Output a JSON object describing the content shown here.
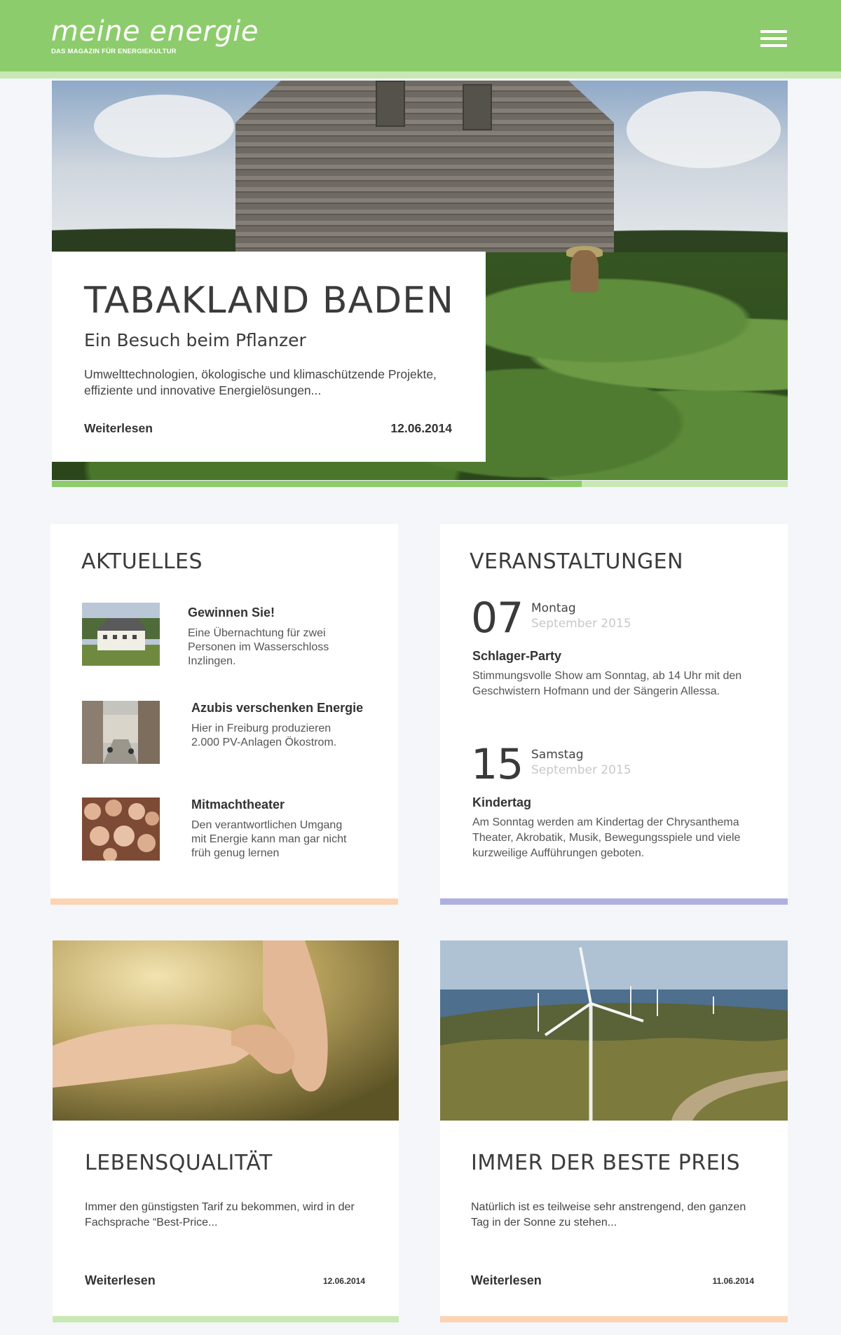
{
  "brand": {
    "title": "meine energie",
    "subtitle": "DAS MAGAZIN FÜR ENERGIEKULTUR"
  },
  "header": {
    "menu_icon": "hamburger-menu-icon",
    "color": "#8dcc6c"
  },
  "hero": {
    "title": "TABAKLAND BADEN",
    "subtitle": "Ein Besuch beim Pflanzer",
    "text": "Umwelttechnologien, ökologische und klimaschützende Projekte, effiziente und innovative Energielösungen...",
    "link": "Weiterlesen",
    "date": "12.06.2014",
    "progress": 0.72
  },
  "aktuelles": {
    "heading": "AKTUELLES",
    "accent": "#fcd4b4",
    "items": [
      {
        "title": "Gewinnen Sie!",
        "text": "Eine Übernachtung für zwei Personen im Wasserschloss Inzlingen."
      },
      {
        "title": "Azubis verschenken Energie",
        "text": "Hier in Freiburg produzieren 2.000 PV-Anlagen Ökostrom."
      },
      {
        "title": "Mitmachtheater",
        "text": "Den verantwortlichen Umgang mit Energie kann man gar nicht früh genug lernen"
      }
    ]
  },
  "veranstaltungen": {
    "heading": "VERANSTALTUNGEN",
    "accent": "#aeb0e0",
    "events": [
      {
        "day": "07",
        "weekday": "Montag",
        "month": "September 2015",
        "title": "Schlager-Party",
        "text": "Stimmungsvolle Show am Sonntag, ab 14 Uhr mit den Geschwistern Hofmann und der Sängerin Allessa."
      },
      {
        "day": "15",
        "weekday": "Samstag",
        "month": "September 2015",
        "title": "Kindertag",
        "text": "Am Sonntag werden am Kindertag der Chrysanthema Theater, Akrobatik, Musik, Bewegungsspiele und viele kurzweilige Aufführungen geboten."
      }
    ]
  },
  "teasers": [
    {
      "heading": "LEBENSQUALITÄT",
      "text": "Immer den günstigsten Tarif zu bekommen, wird in der Fachsprache “Best-Price...",
      "link": "Weiterlesen",
      "date": "12.06.2014",
      "accent": "#c8e8b4"
    },
    {
      "heading": "IMMER DER BESTE PREIS",
      "text": "Natürlich ist es teilweise sehr anstrengend, den ganzen Tag in der Sonne zu stehen...",
      "link": "Weiterlesen",
      "date": "11.06.2014",
      "accent": "#fcd4b4"
    }
  ]
}
